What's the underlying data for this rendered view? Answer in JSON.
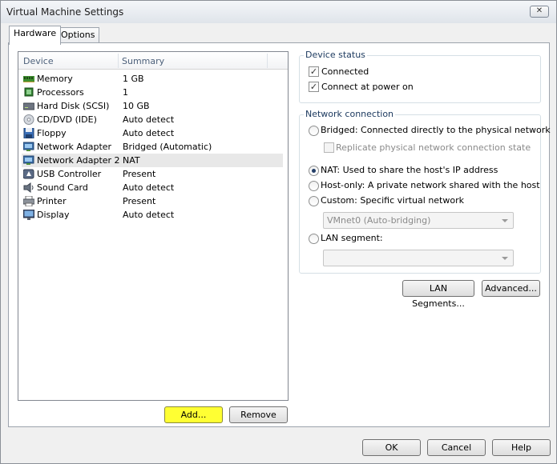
{
  "window": {
    "title": "Virtual Machine Settings",
    "close_glyph": "✕"
  },
  "tabs": [
    {
      "label": "Hardware",
      "active": true
    },
    {
      "label": "Options",
      "active": false
    }
  ],
  "device_list": {
    "columns": [
      "Device",
      "Summary"
    ],
    "rows": [
      {
        "name": "Memory",
        "summary": "1 GB",
        "icon": "memory-icon"
      },
      {
        "name": "Processors",
        "summary": "1",
        "icon": "processor-icon"
      },
      {
        "name": "Hard Disk (SCSI)",
        "summary": "10 GB",
        "icon": "hard-disk-icon"
      },
      {
        "name": "CD/DVD (IDE)",
        "summary": "Auto detect",
        "icon": "cd-dvd-icon"
      },
      {
        "name": "Floppy",
        "summary": "Auto detect",
        "icon": "floppy-icon"
      },
      {
        "name": "Network Adapter",
        "summary": "Bridged (Automatic)",
        "icon": "network-adapter-icon"
      },
      {
        "name": "Network Adapter 2",
        "summary": "NAT",
        "icon": "network-adapter-icon",
        "selected": true
      },
      {
        "name": "USB Controller",
        "summary": "Present",
        "icon": "usb-icon"
      },
      {
        "name": "Sound Card",
        "summary": "Auto detect",
        "icon": "sound-card-icon"
      },
      {
        "name": "Printer",
        "summary": "Present",
        "icon": "printer-icon"
      },
      {
        "name": "Display",
        "summary": "Auto detect",
        "icon": "display-icon"
      }
    ]
  },
  "list_buttons": {
    "add": "Add...",
    "remove": "Remove"
  },
  "device_status": {
    "label": "Device status",
    "connected": {
      "label": "Connected",
      "checked": true
    },
    "connect_at_power_on": {
      "label": "Connect at power on",
      "checked": true
    }
  },
  "network_connection": {
    "label": "Network connection",
    "bridged": "Bridged: Connected directly to the physical network",
    "replicate": "Replicate physical network connection state",
    "nat": "NAT: Used to share the host's IP address",
    "host_only": "Host-only: A private network shared with the host",
    "custom": "Custom: Specific virtual network",
    "custom_select_value": "VMnet0 (Auto-bridging)",
    "lan_segment": "LAN segment:",
    "lan_segment_select_value": "",
    "selected": "nat"
  },
  "panel_buttons": {
    "lan_segments": "LAN Segments...",
    "advanced": "Advanced..."
  },
  "footer_buttons": {
    "ok": "OK",
    "cancel": "Cancel",
    "help": "Help"
  },
  "colors": {
    "highlight": "#ffff33",
    "selected_row": "#e8e8e8",
    "group_label": "#1e3b60"
  }
}
